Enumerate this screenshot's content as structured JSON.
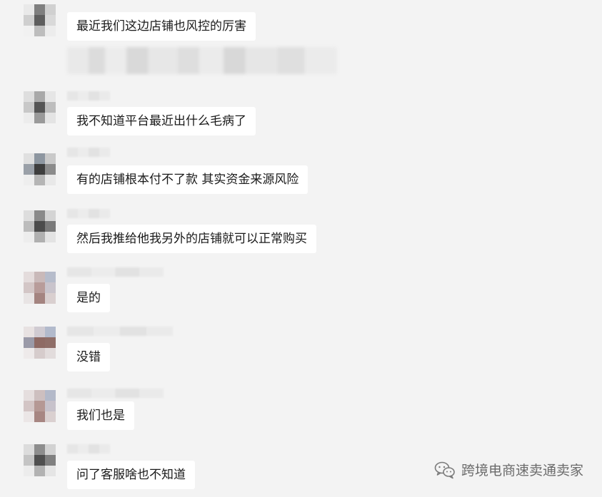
{
  "messages": [
    {
      "text": "最近我们这边店铺也风控的厉害"
    },
    {
      "text": "我不知道平台最近出什么毛病了"
    },
    {
      "text": "有的店铺根本付不了款 其实资金来源风险"
    },
    {
      "text": "然后我推给他我另外的店铺就可以正常购买"
    },
    {
      "text": "是的"
    },
    {
      "text": "没错"
    },
    {
      "text": "我们也是"
    },
    {
      "text": "问了客服啥也不知道"
    }
  ],
  "watermark": {
    "text": "跨境电商速卖通卖家",
    "icon": "wechat-icon"
  },
  "colors": {
    "background": "#f3f3f3",
    "bubble": "#ffffff"
  }
}
